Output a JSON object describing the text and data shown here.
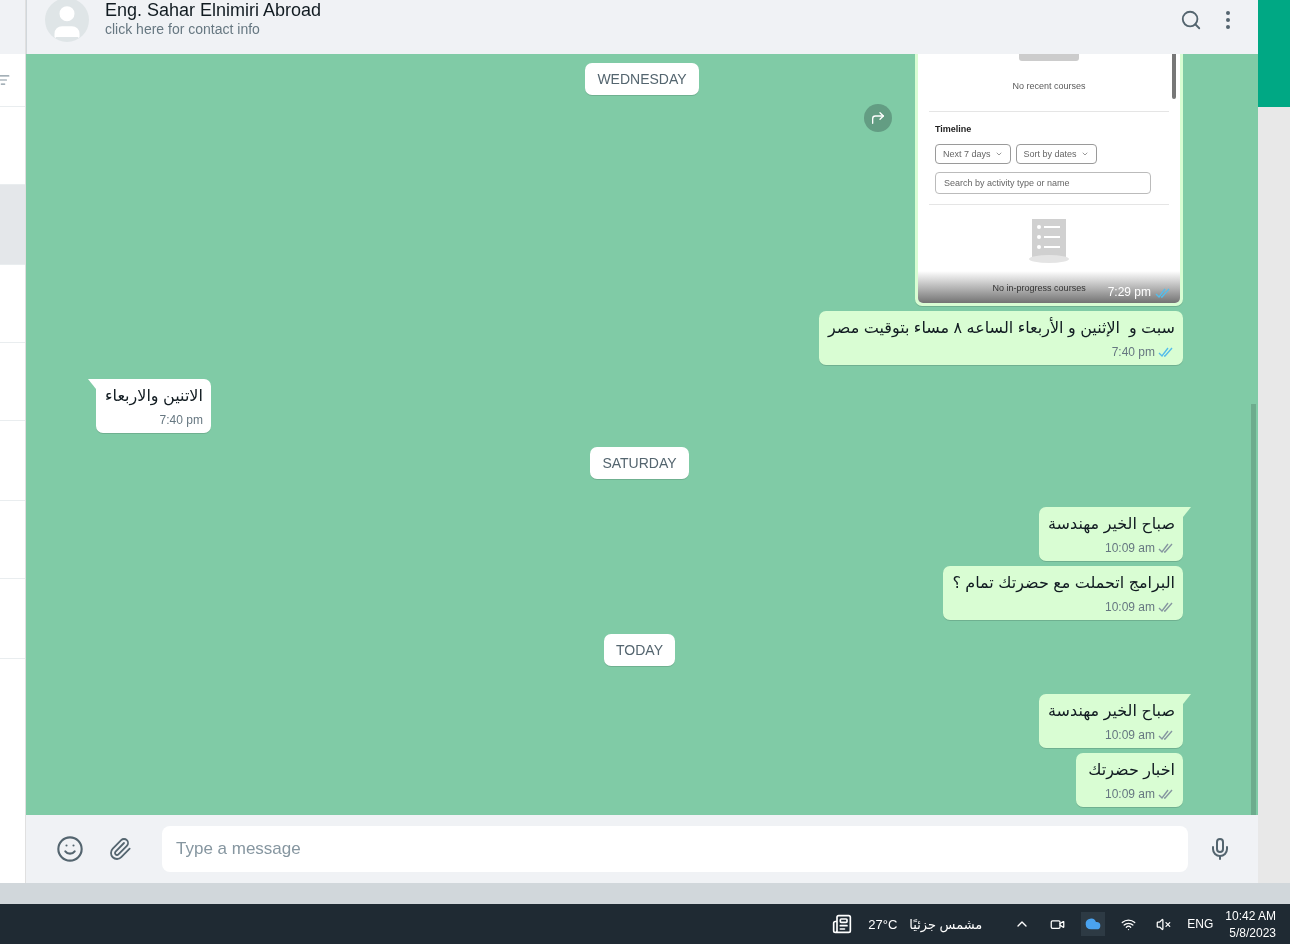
{
  "chat_header": {
    "name": "Eng. Sahar Elnimiri Abroad",
    "subtitle": "click here for contact info"
  },
  "chat_list": [
    {
      "selected": false
    },
    {
      "selected": true
    },
    {
      "selected": false
    },
    {
      "selected": false
    },
    {
      "selected": false
    },
    {
      "selected": false
    },
    {
      "selected": false
    }
  ],
  "sticky_date": "WEDNESDAY",
  "messages": [
    {
      "kind": "image",
      "outgoing": true,
      "time": "7:29 pm",
      "read": true,
      "shot": {
        "empty_recent": "No recent courses",
        "section": "Timeline",
        "filters": [
          "Next 7 days",
          "Sort by dates"
        ],
        "search_placeholder": "Search by activity type or name",
        "empty_progress": "No in-progress courses"
      }
    },
    {
      "kind": "text",
      "outgoing": true,
      "tail": false,
      "text": "سبت و  الإثنين و الأربعاء الساعه ٨ مساء بتوقيت مصر",
      "time": "7:40 pm",
      "read": true
    },
    {
      "kind": "text",
      "outgoing": false,
      "tail": true,
      "text": "الاتنين والاربعاء",
      "time": "7:40 pm"
    },
    {
      "kind": "date",
      "text": "SATURDAY"
    },
    {
      "kind": "text",
      "outgoing": true,
      "tail": true,
      "text": "صباح الخير مهندسة",
      "time": "10:09 am",
      "read": false
    },
    {
      "kind": "text",
      "outgoing": true,
      "tail": false,
      "text": "البرامج اتحملت مع حضرتك تمام ؟",
      "time": "10:09 am",
      "read": false
    },
    {
      "kind": "date",
      "text": "TODAY"
    },
    {
      "kind": "text",
      "outgoing": true,
      "tail": true,
      "text": "صباح الخير مهندسة",
      "time": "10:09 am",
      "read": false
    },
    {
      "kind": "text",
      "outgoing": true,
      "tail": false,
      "text": "اخبار حضرتك",
      "time": "10:09 am",
      "read": false
    }
  ],
  "composer": {
    "placeholder": "Type a message"
  },
  "taskbar": {
    "temperature": "27°C",
    "weather": "مشمس جزئيًا",
    "language": "ENG",
    "time": "10:42 AM",
    "date": "5/8/2023"
  }
}
